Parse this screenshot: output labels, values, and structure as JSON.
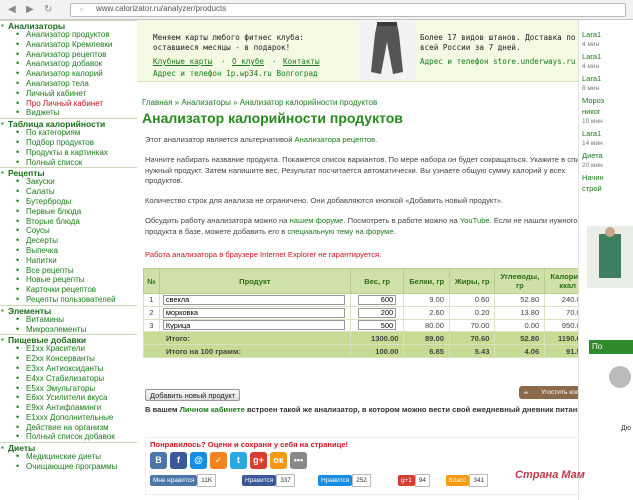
{
  "browser": {
    "url": "www.calorizator.ru/analyzer/products"
  },
  "sidebar": {
    "sections": [
      {
        "title": "Анализаторы",
        "items": [
          {
            "label": "Анализатор продуктов"
          },
          {
            "label": "Анализатор Кремлевки"
          },
          {
            "label": "Анализатор рецептов"
          },
          {
            "label": "Анализатор добавок"
          },
          {
            "label": "Анализатор калорий"
          },
          {
            "label": "Анализатор тела"
          },
          {
            "label": "Личный кабинет"
          },
          {
            "label": "Про Личный кабинет",
            "red": true
          },
          {
            "label": "Виджеты"
          }
        ]
      },
      {
        "title": "Таблица калорийности",
        "items": [
          {
            "label": "По категориям"
          },
          {
            "label": "Подбор продуктов"
          },
          {
            "label": "Продукты в картинках"
          },
          {
            "label": "Полный список"
          }
        ]
      },
      {
        "title": "Рецепты",
        "items": [
          {
            "label": "Закуски"
          },
          {
            "label": "Салаты"
          },
          {
            "label": "Бутерброды"
          },
          {
            "label": "Первые блюда"
          },
          {
            "label": "Вторые блюда"
          },
          {
            "label": "Соусы"
          },
          {
            "label": "Десерты"
          },
          {
            "label": "Выпечка"
          },
          {
            "label": "Напитки"
          },
          {
            "label": "Все рецепты"
          },
          {
            "label": "Новые рецепты"
          },
          {
            "label": "Карточки рецептов"
          },
          {
            "label": "Рецепты пользователей"
          }
        ]
      },
      {
        "title": "Элементы",
        "items": [
          {
            "label": "Витамины"
          },
          {
            "label": "Микроэлементы"
          }
        ]
      },
      {
        "title": "Пищевые добавки",
        "items": [
          {
            "label": "E1xx Красители"
          },
          {
            "label": "E2xx Консерванты"
          },
          {
            "label": "E3xx Антиоксиданты"
          },
          {
            "label": "E4xx Стабилизаторы"
          },
          {
            "label": "E5xx Эмульгаторы"
          },
          {
            "label": "E6xx Усилители вкуса"
          },
          {
            "label": "E9xx Антифламинги"
          },
          {
            "label": "E1xxx Дополнительные"
          },
          {
            "label": "Действие на организм"
          },
          {
            "label": "Полный список добавок"
          }
        ]
      },
      {
        "title": "Диеты",
        "items": [
          {
            "label": "Медицинские диеты"
          },
          {
            "label": "Очищающие программы"
          }
        ]
      }
    ]
  },
  "banner": {
    "left_line1": "Меняем карты любого фитнес клуба:",
    "left_line2": "оставшиеся месяцы - в подарок!",
    "left_links": [
      "Клубные карты",
      "О клубе",
      "Контакты"
    ],
    "left_addr": "Адрес и телефон  1р.wp34.ru Волгоград",
    "right_line1": "Более 17 видов штанов. Доставка по",
    "right_line2": "всей России за 7 дней.",
    "right_addr": "Адрес и телефон  store.underways.ru"
  },
  "main": {
    "breadcrumb": "Главная » Анализаторы » Анализатор калорийности продуктов",
    "title": "Анализатор калорийности продуктов",
    "p1_pre": "Этот анализатор является альтернативой ",
    "p1_link": "Анализатора рецептов",
    "p1_post": ".",
    "p2": "Начните набирать название продукта. Покажется список вариантов. По мере набора он будет сокращаться. Укажите в списке нужный продукт. Затем напишите вес. Результат посчитается автоматически. Вы узнаете общую сумму калорий у всех продуктов.",
    "p3": "Количество строк для анализа не ограничено. Они добавляются кнопкой «Добавить новый продукт».",
    "p4_a": "Обсудить работу анализатора можно на ",
    "p4_link1": "нашем форуме",
    "p4_b": ". Посмотреть в работе можно на ",
    "p4_link2": "YouTube",
    "p4_c": ". Если не нашли нужного продукта в базе, можете добавить его в ",
    "p4_link3": "специальную тему на форуме",
    "p4_d": ".",
    "warning": "Работа анализатора в браузере Internet Explorer не гарантируется."
  },
  "table": {
    "headers": [
      "№",
      "Продукт",
      "Вес, гр",
      "Белки, гр",
      "Жиры, гр",
      "Углеводы, гр",
      "Калории, ккал"
    ],
    "rows": [
      {
        "n": "1",
        "product": "свекла",
        "weight": "600",
        "protein": "9.00",
        "fat": "0.60",
        "carbs": "52.80",
        "kcal": "240.00"
      },
      {
        "n": "2",
        "product": "морковка",
        "weight": "200",
        "protein": "2.60",
        "fat": "0.20",
        "carbs": "13.80",
        "kcal": "70.00"
      },
      {
        "n": "3",
        "product": "Курица",
        "weight": "500",
        "protein": "80.00",
        "fat": "70.00",
        "carbs": "0.00",
        "kcal": "950.00"
      }
    ],
    "total": {
      "label": "Итого:",
      "weight": "1300.00",
      "protein": "89.00",
      "fat": "70.60",
      "carbs": "52.80",
      "kcal": "1190.00"
    },
    "per100": {
      "label": "Итого на 100 грамм:",
      "weight": "100.00",
      "protein": "6.85",
      "fat": "5.43",
      "carbs": "4.06",
      "kcal": "91.54"
    }
  },
  "actions": {
    "add_button": "Добавить новый продукт",
    "coffee": "Угостить кофе"
  },
  "cabinet": {
    "pre": "В вашем ",
    "link": "Личном кабинете",
    "post": " встроен такой же анализатор, в котором можно вести свой ежедневный дневник питания."
  },
  "share": {
    "question": "Понравилось? Оцени и сохрани у себя на странице!",
    "icons": [
      {
        "glyph": "В",
        "color": "#4a76a8"
      },
      {
        "glyph": "f",
        "color": "#3b5998"
      },
      {
        "glyph": "@",
        "color": "#168de2"
      },
      {
        "glyph": "✓",
        "color": "#f58220"
      },
      {
        "glyph": "t",
        "color": "#2ca7e0"
      },
      {
        "glyph": "g+",
        "color": "#d73d32"
      },
      {
        "glyph": "ок",
        "color": "#f59a12"
      },
      {
        "glyph": "•••",
        "color": "#888888"
      }
    ],
    "counters": [
      {
        "label": "Мне нравится",
        "count": "11K",
        "color": "#4a76a8"
      },
      {
        "label": "Нравится",
        "count": "337",
        "color": "#3b5998"
      },
      {
        "label": "Нравится",
        "count": "252",
        "color": "#168de2"
      },
      {
        "label": "g+1",
        "count": "94",
        "color": "#d73d32"
      },
      {
        "label": "Класс",
        "count": "341",
        "color": "#f59a12"
      }
    ]
  },
  "right": {
    "items": [
      {
        "text": "Lara1",
        "cls": "g"
      },
      {
        "text": "4 мин",
        "cls": "gr"
      },
      {
        "text": "Lara1",
        "cls": "g"
      },
      {
        "text": "4 мин",
        "cls": "gr"
      },
      {
        "text": "Lara1",
        "cls": "g"
      },
      {
        "text": "8 мин",
        "cls": "gr"
      },
      {
        "text": "Мороз",
        "cls": "g"
      },
      {
        "text": "никог",
        "cls": "g"
      },
      {
        "text": "10 мин",
        "cls": "gr"
      },
      {
        "text": "Lara1",
        "cls": "g"
      },
      {
        "text": "14 мин",
        "cls": "gr"
      },
      {
        "text": "Диета",
        "cls": "g"
      },
      {
        "text": "20 мин",
        "cls": "gr"
      },
      {
        "text": "Начин",
        "cls": "g"
      },
      {
        "text": "строй",
        "cls": "g"
      }
    ],
    "tab": "По",
    "caption": "Дю",
    "watermark": "Страна Мам"
  }
}
